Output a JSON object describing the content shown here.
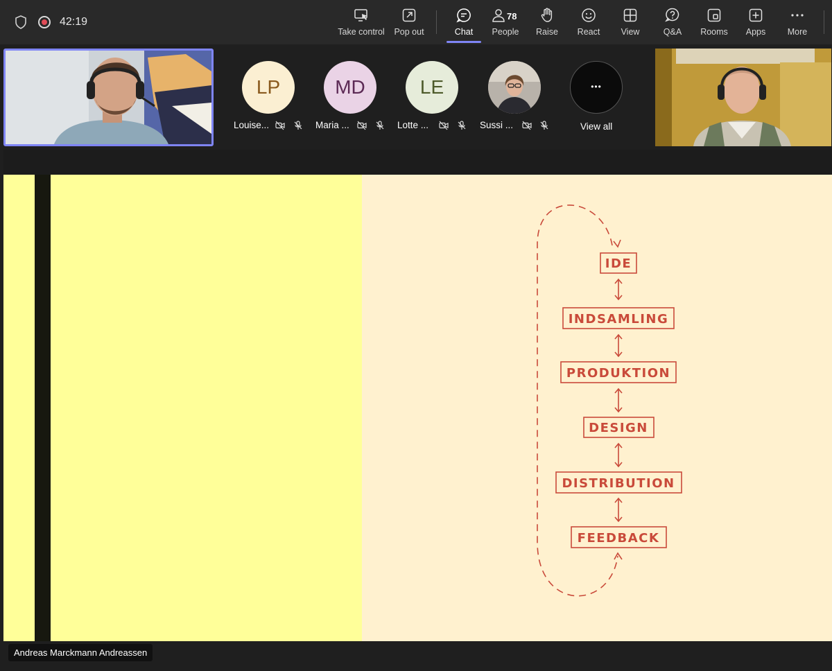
{
  "meeting": {
    "timer": "42:19"
  },
  "toolbar": {
    "items": [
      {
        "label": "Take control",
        "icon": "take-control-icon"
      },
      {
        "label": "Pop out",
        "icon": "pop-out-icon"
      },
      {
        "label": "Chat",
        "icon": "chat-icon",
        "active": true
      },
      {
        "label": "People",
        "icon": "people-icon",
        "count": "78"
      },
      {
        "label": "Raise",
        "icon": "raise-hand-icon"
      },
      {
        "label": "React",
        "icon": "react-icon"
      },
      {
        "label": "View",
        "icon": "view-icon"
      },
      {
        "label": "Q&A",
        "icon": "qa-icon"
      },
      {
        "label": "Rooms",
        "icon": "rooms-icon"
      },
      {
        "label": "Apps",
        "icon": "apps-icon"
      },
      {
        "label": "More",
        "icon": "more-icon"
      }
    ]
  },
  "participants": [
    {
      "initials": "LP",
      "name": "Louise...",
      "avatar_bg": "#fbefd2",
      "avatar_fg": "#8a5a1e"
    },
    {
      "initials": "MD",
      "name": "Maria ...",
      "avatar_bg": "#ead3e6",
      "avatar_fg": "#5c2a55"
    },
    {
      "initials": "LE",
      "name": "Lotte ...",
      "avatar_bg": "#e6ecda",
      "avatar_fg": "#4d5a2a"
    },
    {
      "initials": "",
      "name": "Sussi ...",
      "avatar_bg": "#9a8f86",
      "avatar_fg": "#ffffff"
    }
  ],
  "view_all": {
    "label": "View all",
    "glyph": "•••"
  },
  "slide": {
    "steps": [
      "IDE",
      "INDSAMLING",
      "PRODUKTION",
      "DESIGN",
      "DISTRIBUTION",
      "FEEDBACK"
    ],
    "colors": {
      "left_panel": "#ffff99",
      "right_panel": "#fff1cf",
      "accent": "#c94a3a",
      "bar": "#17180f"
    }
  },
  "presenter": {
    "name": "Andreas Marckmann Andreassen"
  }
}
